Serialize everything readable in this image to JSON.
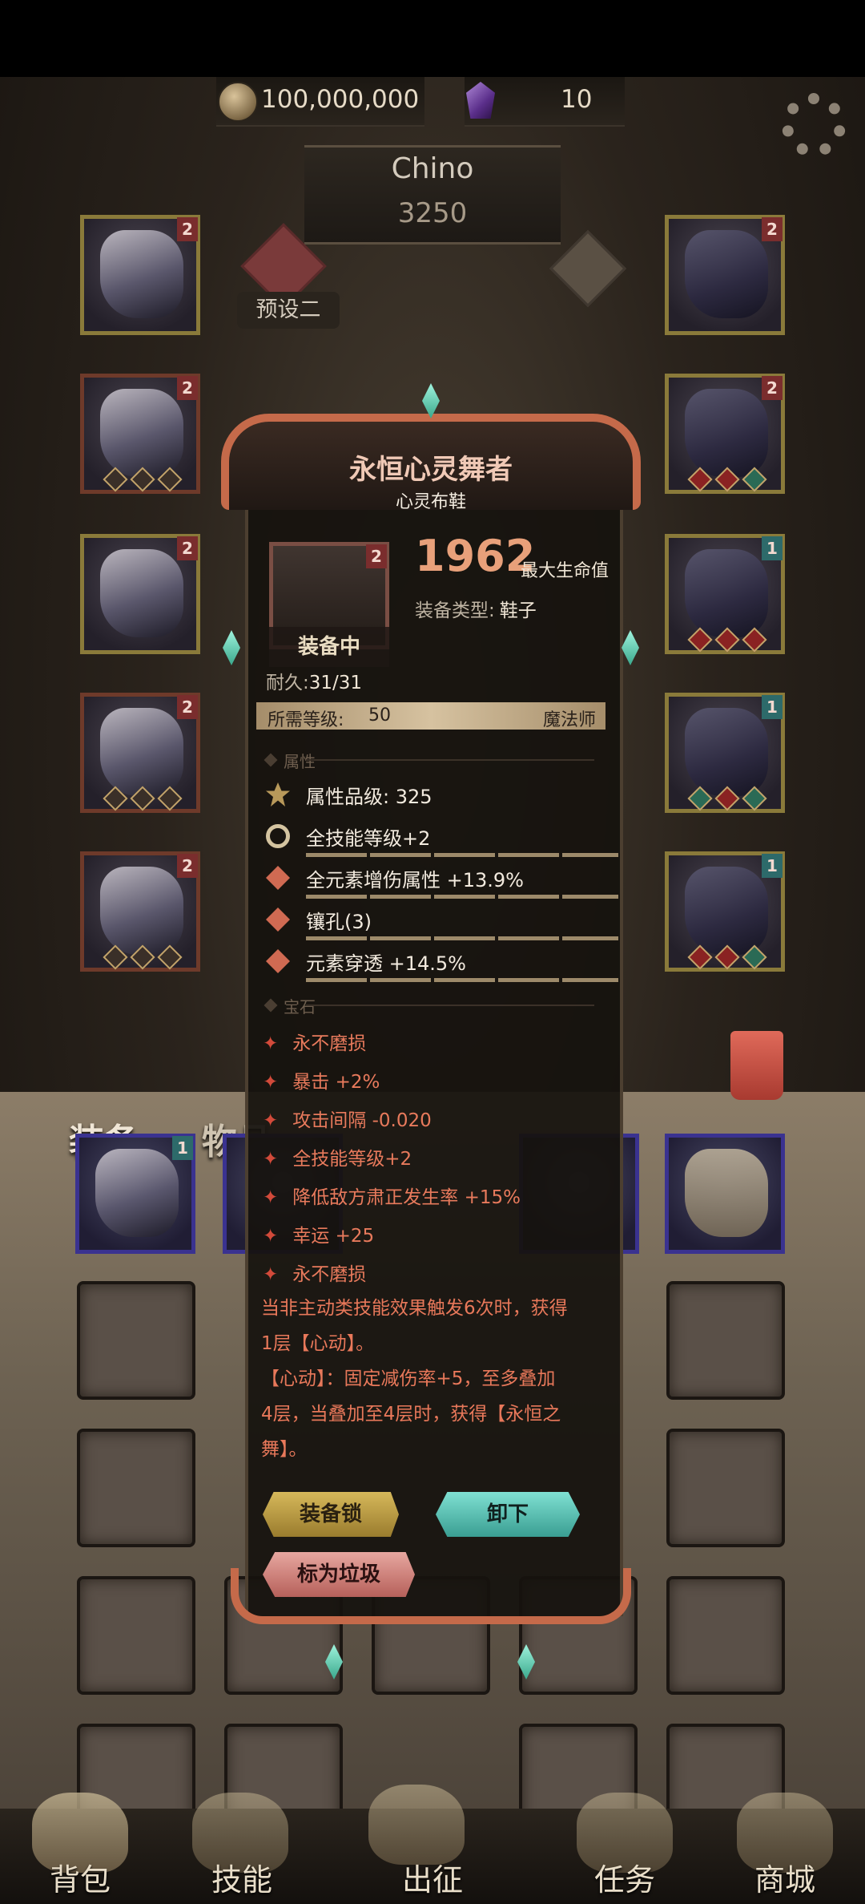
{
  "currency": {
    "gold": "100,000,000",
    "gems": "10"
  },
  "player": {
    "name": "Chino",
    "power": "3250"
  },
  "preset": {
    "label": "预设二"
  },
  "item": {
    "name": "永恒心灵舞者",
    "subtype": "心灵布鞋",
    "badge": "2",
    "status": "装备中",
    "stat_value": "1962",
    "stat_label": "最大生命值",
    "type_label": "装备类型:",
    "type_value": "鞋子",
    "durability_label": "耐久:",
    "durability_value": "31/31",
    "req_level_label": "所需等级:",
    "req_level_value": "50",
    "req_class": "魔法师"
  },
  "sections": {
    "attributes": "属性",
    "gems": "宝石"
  },
  "attributes": [
    {
      "text": "属性品级: 325",
      "icon": "crown-icon"
    },
    {
      "text": "全技能等级+2",
      "icon": "cycle-icon"
    },
    {
      "text": "全元素增伤属性 +13.9%",
      "icon": "spark-icon"
    },
    {
      "text": "镶孔(3)",
      "icon": "spark-icon"
    },
    {
      "text": "元素穿透 +14.5%",
      "icon": "spark-icon"
    }
  ],
  "gem_effects": [
    "永不磨损",
    "暴击 +2%",
    "攻击间隔 -0.020",
    "全技能等级+2",
    "降低敌方肃正发生率 +15%",
    "幸运 +25",
    "永不磨损"
  ],
  "description": [
    "当非主动类技能效果触发6次时，获得",
    "1层【心动】。",
    "【心动】：固定减伤率+5，至多叠加",
    "4层，当叠加至4层时，获得【永恒之",
    "舞】。"
  ],
  "buttons": {
    "lock": "装备锁",
    "unequip": "卸下",
    "trash": "标为垃圾"
  },
  "tabs": {
    "equipment": "装备",
    "items": "物品"
  },
  "nav": [
    "背包",
    "技能",
    "出征",
    "任务",
    "商城"
  ],
  "colors": {
    "accent": "#c56a4a",
    "teal": "#7fe0d2",
    "gold": "#d6b85a"
  }
}
